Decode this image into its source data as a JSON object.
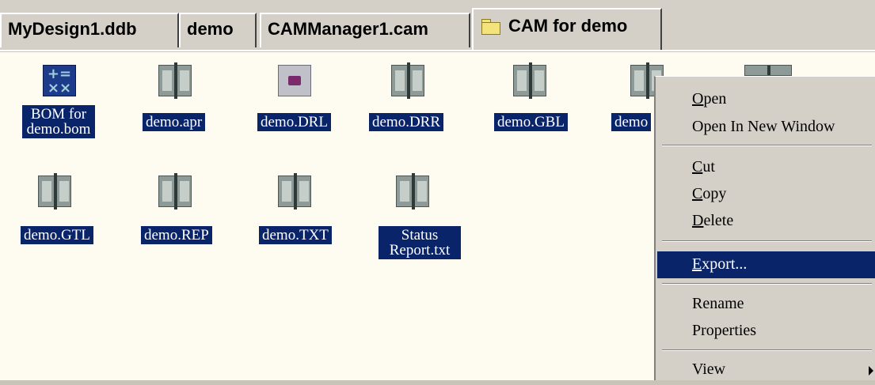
{
  "tabs": [
    {
      "label": "MyDesign1.ddb"
    },
    {
      "label": "demo"
    },
    {
      "label": "CAMManager1.cam"
    },
    {
      "label": "CAM for demo",
      "icon": "folder-icon",
      "active": true
    }
  ],
  "files": [
    {
      "name": "BOM for demo.bom",
      "icon": "bom-icon",
      "selected": true
    },
    {
      "name": "demo.apr",
      "icon": "book-icon",
      "selected": true
    },
    {
      "name": "demo.DRL",
      "icon": "drill-file-icon",
      "selected": true
    },
    {
      "name": "demo.DRR",
      "icon": "book-icon",
      "selected": true
    },
    {
      "name": "demo.GBL",
      "icon": "book-icon",
      "selected": true
    },
    {
      "name": "demo",
      "icon": "book-icon",
      "selected": true
    },
    {
      "name": "",
      "icon": "book-icon",
      "selected": true
    },
    {
      "name": "demo.GTL",
      "icon": "book-icon",
      "selected": true
    },
    {
      "name": "demo.REP",
      "icon": "book-icon",
      "selected": true
    },
    {
      "name": "demo.TXT",
      "icon": "book-icon",
      "selected": true
    },
    {
      "name": "Status Report.txt",
      "icon": "book-icon",
      "selected": true
    }
  ],
  "bom_icon_glyphs": {
    "top": "+=",
    "bottom": "××"
  },
  "context_menu": {
    "items": [
      {
        "label": "Open",
        "accel": "O"
      },
      {
        "label": "Open In New Window"
      },
      {
        "label": "Cut",
        "accel": "C"
      },
      {
        "label": "Copy",
        "accel": "C"
      },
      {
        "label": "Delete",
        "accel": "D"
      },
      {
        "label": "Export...",
        "accel": "E",
        "selected": true
      },
      {
        "label": "Rename"
      },
      {
        "label": "Properties"
      },
      {
        "label": "View",
        "has_submenu": true
      }
    ]
  },
  "colors": {
    "selection": "#0a246a",
    "selection_text": "#ffffff",
    "panel_background": "#fefcf0",
    "menu_background": "#d4d0c8"
  }
}
